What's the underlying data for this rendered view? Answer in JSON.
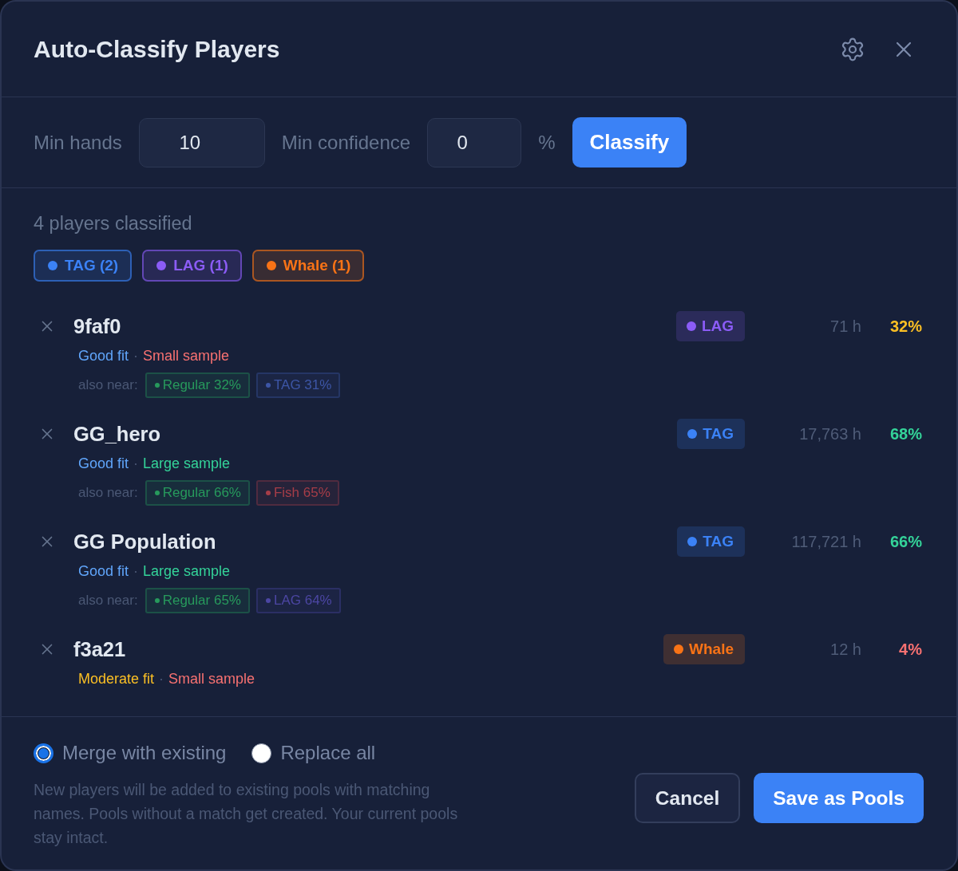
{
  "dialog": {
    "title": "Auto-Classify Players"
  },
  "filters": [
    {
      "label": "Min hands",
      "value": "10"
    },
    {
      "label": "Min confidence",
      "value": "0",
      "suffix": "%"
    }
  ],
  "classify_button": "Classify",
  "summary": {
    "text": "4 players classified",
    "chips": [
      {
        "label": "TAG (2)",
        "color": "#3b82f6"
      },
      {
        "label": "LAG (1)",
        "color": "#8b5cf6"
      },
      {
        "label": "Whale (1)",
        "color": "#f97316"
      }
    ]
  },
  "players": [
    {
      "name": "9faf0",
      "fit": {
        "label": "Good fit",
        "color": "#60a5fa"
      },
      "separator": "·",
      "sample": {
        "label": "Small sample",
        "color": "#f87171"
      },
      "also_near_label": "also near:",
      "also_near": [
        {
          "label": "Regular 32%",
          "color": "#279a5c"
        },
        {
          "label": "TAG 31%",
          "color": "#3d56a6"
        }
      ],
      "class": {
        "label": "LAG",
        "color": "#8b5cf6"
      },
      "hours": "71 h",
      "confidence": {
        "text": "32%",
        "color": "#fbbf24"
      }
    },
    {
      "name": "GG_hero",
      "fit": {
        "label": "Good fit",
        "color": "#60a5fa"
      },
      "separator": "·",
      "sample": {
        "label": "Large sample",
        "color": "#34d399"
      },
      "also_near_label": "also near:",
      "also_near": [
        {
          "label": "Regular 66%",
          "color": "#279a5c"
        },
        {
          "label": "Fish 65%",
          "color": "#a63d48"
        }
      ],
      "class": {
        "label": "TAG",
        "color": "#3b82f6"
      },
      "hours": "17,763 h",
      "confidence": {
        "text": "68%",
        "color": "#34d399"
      }
    },
    {
      "name": "GG Population",
      "fit": {
        "label": "Good fit",
        "color": "#60a5fa"
      },
      "separator": "·",
      "sample": {
        "label": "Large sample",
        "color": "#34d399"
      },
      "also_near_label": "also near:",
      "also_near": [
        {
          "label": "Regular 65%",
          "color": "#279a5c"
        },
        {
          "label": "LAG 64%",
          "color": "#4c46a3"
        }
      ],
      "class": {
        "label": "TAG",
        "color": "#3b82f6"
      },
      "hours": "117,721 h",
      "confidence": {
        "text": "66%",
        "color": "#34d399"
      }
    },
    {
      "name": "f3a21",
      "fit": {
        "label": "Moderate fit",
        "color": "#fbbf24"
      },
      "separator": "·",
      "sample": {
        "label": "Small sample",
        "color": "#f87171"
      },
      "class": {
        "label": "Whale",
        "color": "#f97316"
      },
      "hours": "12 h",
      "confidence": {
        "text": "4%",
        "color": "#f87171"
      }
    }
  ],
  "mode_options": [
    {
      "label": "Merge with existing",
      "selected": true
    },
    {
      "label": "Replace all",
      "selected": false
    }
  ],
  "description": "New players will be added to existing pools with matching names. Pools without a match get created. Your current pools stay intact.",
  "buttons": [
    {
      "label": "Cancel",
      "kind": "secondary"
    },
    {
      "label": "Save as Pools",
      "kind": "primary"
    }
  ]
}
